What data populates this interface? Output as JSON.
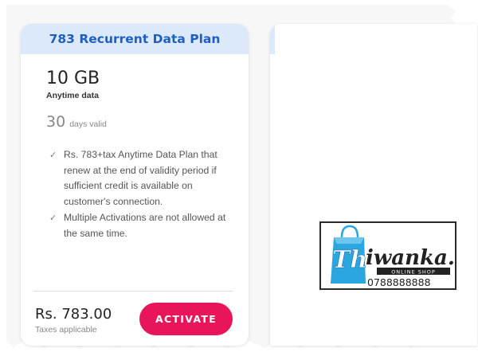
{
  "plan": {
    "title": "783 Recurrent Data Plan",
    "data_amount": "10 GB",
    "data_type": "Anytime data",
    "validity_days": "30",
    "validity_label": "days valid",
    "features": [
      "Rs. 783+tax Anytime Data Plan that renew at the end of validity period if sufficient credit is available on customer's connection.",
      "Multiple Activations are not allowed at the same time."
    ],
    "price": "Rs. 783.00",
    "price_note": "Taxes applicable",
    "activate_label": "ACTIVATE"
  },
  "watermark": {
    "brand": "Thiwanka.lk",
    "tagline": "ONLINE SHOP",
    "phone": "0788888888"
  },
  "colors": {
    "header_bg": "#dbe9fb",
    "title": "#1f5fc2",
    "activate_button": "#e8155b",
    "logo_bag": "#2ba6de"
  },
  "icons": [
    "checkmark-icon",
    "shopping-bag-icon"
  ]
}
